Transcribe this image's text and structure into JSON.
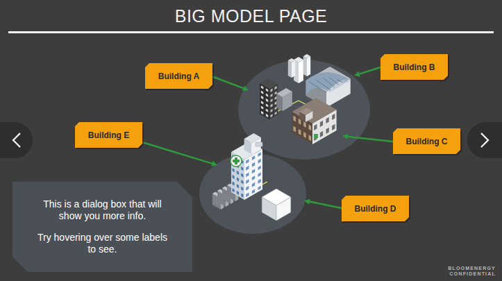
{
  "title": "BIG MODEL PAGE",
  "labels": [
    "Building A",
    "Building B",
    "Building C",
    "Building E",
    "Building D"
  ],
  "dialog": {
    "paragraphs": [
      "This is a dialog box that will show you more info.",
      "Try hovering over some labels to see."
    ]
  },
  "footer": [
    "BLOOMENERGY",
    "CONFIDENTIAL"
  ]
}
